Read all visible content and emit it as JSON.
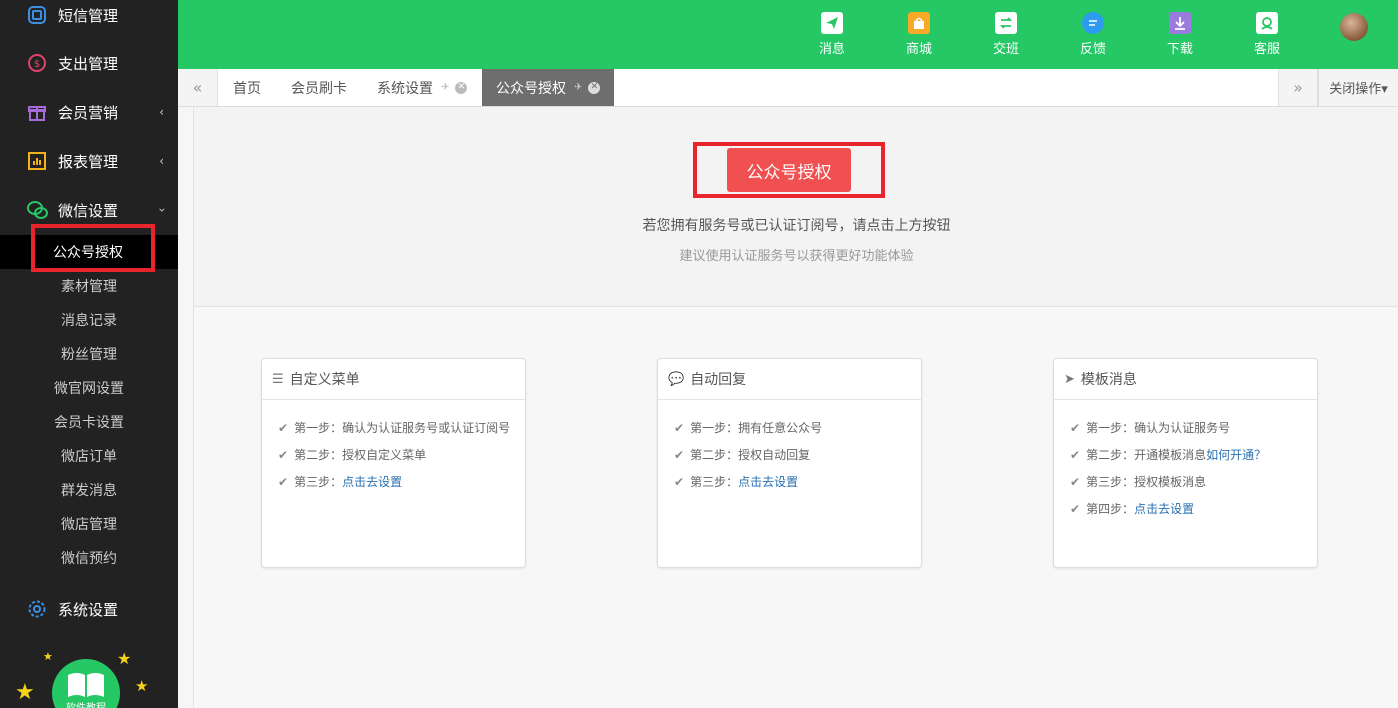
{
  "sidebar": {
    "menu": [
      {
        "label": "短信管理",
        "icon": "sms-icon"
      },
      {
        "label": "支出管理",
        "icon": "expense-icon"
      },
      {
        "label": "会员营销",
        "icon": "gift-icon",
        "chevron": "‹"
      },
      {
        "label": "报表管理",
        "icon": "report-icon",
        "chevron": "‹"
      },
      {
        "label": "微信设置",
        "icon": "wechat-icon",
        "chevron": "‹"
      }
    ],
    "submenu": [
      "公众号授权",
      "素材管理",
      "消息记录",
      "粉丝管理",
      "微官网设置",
      "会员卡设置",
      "微店订单",
      "群发消息",
      "微店管理",
      "微信预约"
    ],
    "system": {
      "label": "系统设置",
      "icon": "gear-icon"
    },
    "help_label": "软件教程"
  },
  "topbar": {
    "buttons": [
      {
        "label": "消息",
        "icon": "message-icon"
      },
      {
        "label": "商城",
        "icon": "shop-icon"
      },
      {
        "label": "交班",
        "icon": "shift-icon"
      },
      {
        "label": "反馈",
        "icon": "feedback-icon"
      },
      {
        "label": "下载",
        "icon": "download-icon"
      },
      {
        "label": "客服",
        "icon": "service-icon"
      }
    ]
  },
  "tabs": {
    "items": [
      "首页",
      "会员刷卡",
      "系统设置",
      "公众号授权"
    ],
    "close_ops": "关闭操作▾"
  },
  "auth": {
    "button": "公众号授权",
    "hint1": "若您拥有服务号或已认证订阅号，请点击上方按钮",
    "hint2": "建议使用认证服务号以获得更好功能体验"
  },
  "cards": [
    {
      "title": "自定义菜单",
      "icon": "list-icon",
      "steps": [
        {
          "text": "第一步：确认为认证服务号或认证订阅号",
          "link": ""
        },
        {
          "text": "第二步：授权自定义菜单",
          "link": ""
        },
        {
          "text": "第三步：",
          "link": "点击去设置"
        }
      ]
    },
    {
      "title": "自动回复",
      "icon": "comments-icon",
      "steps": [
        {
          "text": "第一步：拥有任意公众号",
          "link": ""
        },
        {
          "text": "第二步：授权自动回复",
          "link": ""
        },
        {
          "text": "第三步：",
          "link": "点击去设置"
        }
      ]
    },
    {
      "title": "模板消息",
      "icon": "send-icon",
      "steps": [
        {
          "text": "第一步：确认为认证服务号",
          "link": ""
        },
        {
          "text": "第二步：开通模板消息 ",
          "link": "如何开通？"
        },
        {
          "text": "第三步：授权模板消息",
          "link": ""
        },
        {
          "text": "第四步：",
          "link": "点击去设置"
        }
      ]
    }
  ],
  "colors": {
    "brand_green": "#25c865",
    "sidebar_bg": "#222222",
    "accent_red": "#f0504f",
    "highlight_box": "#e8242c",
    "link_blue": "#2a6fb2"
  }
}
